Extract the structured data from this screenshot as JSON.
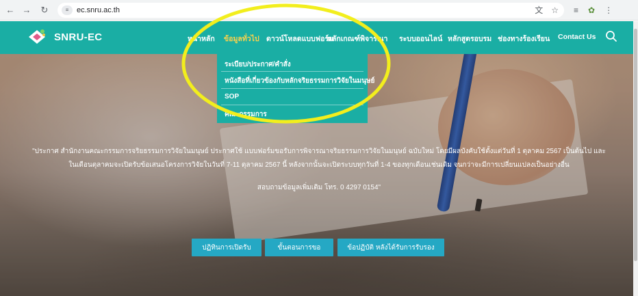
{
  "browser": {
    "url": "ec.snru.ac.th",
    "icons": [
      "back-icon",
      "forward-icon",
      "reload-icon",
      "site-info-icon",
      "translate-icon",
      "bookmark-star-icon",
      "reading-list-icon",
      "extension-icon",
      "menu-dots-icon"
    ]
  },
  "site": {
    "brand": "SNRU-EC",
    "nav": {
      "home": "หน้าหลัก",
      "general": "ข้อมูลทั่วไป",
      "download": "ดาวน์โหลดแบบฟอร์ม",
      "criteria": "หลักเกณฑ์พิจารณา",
      "online": "ระบบออนไลน์",
      "courses": "หลักสูตรอบรม",
      "complaint": "ช่องทางร้องเรียน",
      "contact": "Contact Us"
    },
    "dropdown": {
      "item1": "ระเบียบ/ประกาศ/คำสั่ง",
      "item2": "หนังสือที่เกี่ยวข้องกับหลักจริยธรรมการวิจัยในมนุษย์",
      "item3": "SOP",
      "item4": "คณะกรรมการ"
    },
    "notice": {
      "line1": "\"ประกาศ สำนักงานคณะกรรมการจริยธรรมการวิจัยในมนุษย์ ประกาศใช้ แบบฟอร์มขอรับการพิจารณาจริยธรรมการวิจัยในมนุษย์ ฉบับใหม่ โดยมีผลบังคับใช้ตั้งแต่วันที่ 1 ตุลาคม 2567 เป็นต้นไป และ",
      "line2": "ในเดือนตุลาคมจะเปิดรับข้อเสนอโครงการวิจัยในวันที่ 7-11 ตุลาคม 2567 นี้ หลังจากนั้นจะเปิดระบบทุกวันที่ 1-4 ของทุกเดือนเช่นเดิม จนกว่าจะมีการเปลี่ยนแปลงเป็นอย่างอื่น",
      "line3": "สอบถามข้อมูลเพิ่มเติม โทร. 0 4297 0154\""
    },
    "buttons": {
      "calendar": "ปฏิทินการเปิดรับ",
      "steps": "ขั้นตอนการขอ",
      "after_approval": "ข้อปฏิบัติ หลังได้รับการรับรอง"
    },
    "colors": {
      "teal": "#1aaea4",
      "active_menu": "#ffd34a",
      "button": "#25a8c4",
      "highlight": "#f2ee1d"
    }
  }
}
